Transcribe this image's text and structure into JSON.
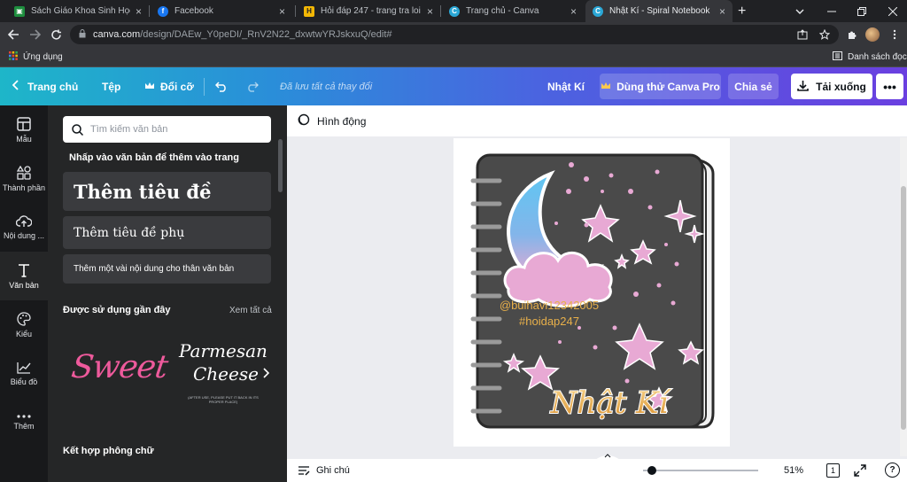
{
  "browser": {
    "tabs": [
      {
        "title": "Sách Giáo Khoa Sinh Học Lớp",
        "close": "×",
        "fav_color": "#1e8e3e",
        "fav_glyph": "▣"
      },
      {
        "title": "Facebook",
        "close": "×",
        "fav_color": "#1877f2",
        "fav_glyph": "f"
      },
      {
        "title": "Hỏi đáp 247 - trang tra loi",
        "close": "×",
        "fav_color": "#f2b705",
        "fav_glyph": "H"
      },
      {
        "title": "Trang chủ - Canva",
        "close": "×",
        "fav_color": "#2aa7d6",
        "fav_glyph": "C"
      },
      {
        "title": "Nhật Kí - Spiral Notebook",
        "close": "×",
        "fav_color": "#2aa7d6",
        "fav_glyph": "C"
      }
    ],
    "new_tab": "+",
    "url_host": "canva.com",
    "url_path": "/design/DAEw_Y0peDI/_RnV2N22_dxwtwYRJskxuQ/edit#",
    "bookmarks": {
      "apps": "Ứng dụng",
      "reading_list": "Danh sách đọc"
    }
  },
  "canva_header": {
    "home": "Trang chủ",
    "file": "Tệp",
    "resize": "Đổi cỡ",
    "saved": "Đã lưu tất cả thay đổi",
    "doc_title": "Nhật Kí",
    "try_pro": "Dùng thử Canva Pro",
    "share": "Chia sẻ",
    "download": "Tải xuống",
    "more": "•••"
  },
  "rail": [
    {
      "label": "Mẫu",
      "icon": "template-icon"
    },
    {
      "label": "Thành phần",
      "icon": "elements-icon"
    },
    {
      "label": "Nội dung ...",
      "icon": "upload-icon"
    },
    {
      "label": "Văn bản",
      "icon": "text-icon"
    },
    {
      "label": "Kiểu",
      "icon": "palette-icon"
    },
    {
      "label": "Biểu đồ",
      "icon": "chart-icon"
    },
    {
      "label": "Thêm",
      "icon": "more-icon"
    }
  ],
  "panel": {
    "search_placeholder": "Tìm kiếm văn bản",
    "hint": "Nhấp vào văn bản để thêm vào trang",
    "heading": "Thêm tiêu đề",
    "subheading": "Thêm tiêu đề phụ",
    "body": "Thêm một vài nội dung cho thân văn bản",
    "recent_title": "Được sử dụng gần đây",
    "see_all": "Xem tất cả",
    "font_sweet": "Sweet",
    "font_parmesan_1": "Parmesan",
    "font_parmesan_2": "Cheese",
    "font_parmesan_note": "(AFTER USE, PLEASE PUT IT BACK IN ITS PROPER PLACE)",
    "combine_title": "Kết hợp phông chữ"
  },
  "workspace": {
    "animate": "Hình động",
    "notes": "Ghi chú",
    "zoom": "51%",
    "page_count": "1",
    "help": "?"
  },
  "notebook": {
    "handle": "@buihavi12342005",
    "hashtag": "#hoidap247",
    "title": "Nhật Kí",
    "cover_color": "#4a4a4a",
    "star_color": "#e8a9d4",
    "text_gold": "#e8b04a"
  },
  "colors": {
    "accent": "#7d2ae8",
    "gradient_start": "#1eb6c9",
    "panel": "#252627"
  }
}
